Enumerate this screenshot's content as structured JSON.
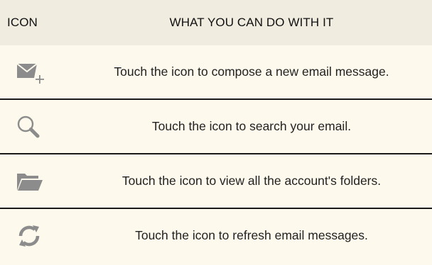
{
  "table": {
    "headers": {
      "icon": "ICON",
      "description": "WHAT YOU CAN DO WITH IT"
    },
    "rows": [
      {
        "icon": "compose-email-icon",
        "text": "Touch the icon to compose a new email message."
      },
      {
        "icon": "search-icon",
        "text": "Touch the icon to search your email."
      },
      {
        "icon": "folder-icon",
        "text": "Touch the icon to view all the account's folders."
      },
      {
        "icon": "refresh-icon",
        "text": "Touch the icon to refresh email messages."
      }
    ]
  },
  "colors": {
    "header_bg": "#f0ece0",
    "row_bg": "#fdf9ec",
    "divider": "#1a1a1a",
    "icon_gray": "#8c8c8c"
  }
}
